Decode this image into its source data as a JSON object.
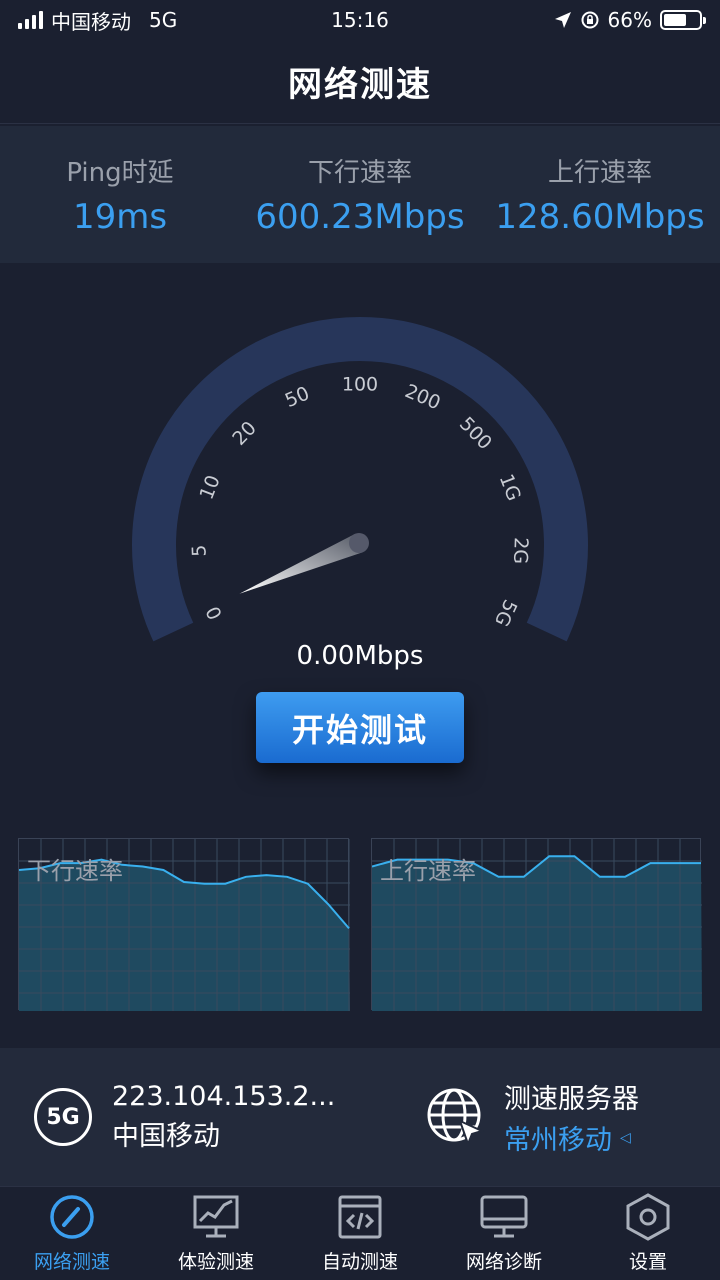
{
  "status_bar": {
    "carrier": "中国移动",
    "network": "5G",
    "time": "15:16",
    "battery": "66%",
    "battery_level": 0.66
  },
  "header": {
    "title": "网络测速"
  },
  "stats": [
    {
      "label": "Ping时延",
      "value": "19ms"
    },
    {
      "label": "下行速率",
      "value": "600.23Mbps"
    },
    {
      "label": "上行速率",
      "value": "128.60Mbps"
    }
  ],
  "gauge": {
    "scale_labels": [
      "0",
      "5",
      "10",
      "20",
      "50",
      "100",
      "200",
      "500",
      "1G",
      "2G",
      "5G"
    ],
    "current_value": 0,
    "readout": "0.00Mbps"
  },
  "start_button": {
    "label": "开始测试"
  },
  "graphs": [
    {
      "label": "下行速率",
      "series": [
        0.82,
        0.83,
        0.86,
        0.86,
        0.88,
        0.85,
        0.84,
        0.82,
        0.75,
        0.74,
        0.74,
        0.78,
        0.79,
        0.78,
        0.74,
        0.62,
        0.48
      ]
    },
    {
      "label": "上行速率",
      "series": [
        0.84,
        0.88,
        0.88,
        0.88,
        0.86,
        0.78,
        0.78,
        0.9,
        0.9,
        0.78,
        0.78,
        0.86,
        0.86,
        0.86
      ]
    }
  ],
  "network_info": {
    "badge": "5G",
    "ip": "223.104.153.2...",
    "carrier": "中国移动",
    "server_title": "测速服务器",
    "server_name": "常州移动"
  },
  "tabs": [
    {
      "label": "网络测速",
      "icon": "speedometer-icon",
      "active": true
    },
    {
      "label": "体验测速",
      "icon": "chart-monitor-icon",
      "active": false
    },
    {
      "label": "自动测速",
      "icon": "code-window-icon",
      "active": false
    },
    {
      "label": "网络诊断",
      "icon": "monitor-icon",
      "active": false
    },
    {
      "label": "设置",
      "icon": "gear-hexagon-icon",
      "active": false
    }
  ],
  "colors": {
    "accent": "#3b9ff0",
    "background": "#1b2030",
    "panel": "#222a3b",
    "gauge_track": "#27365a"
  }
}
